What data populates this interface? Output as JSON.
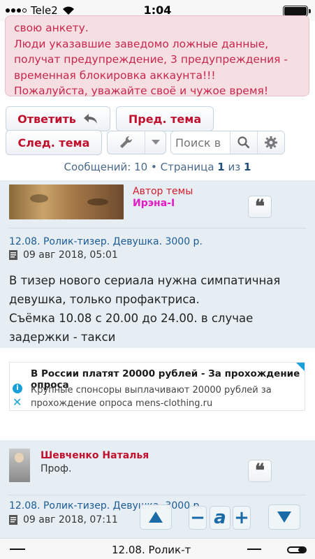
{
  "status_bar": {
    "carrier": "Tele2",
    "time": "1:04"
  },
  "warning": {
    "lines": [
      "свою анкету.",
      "Люди указавшие заведомо ложные данные,",
      "получат предупреждение, 3 предупреждения -",
      "временная блокировка аккаунта!!!",
      "Пожалуйста, уважайте своё и чужое время!"
    ]
  },
  "toolbar": {
    "reply_label": "Ответить",
    "prev_topic_label": "Пред. тема",
    "next_topic_label": "След. тема",
    "search_placeholder": "Поиск в"
  },
  "pagination": {
    "messages_label": "Сообщений:",
    "messages_count": "10",
    "separator": "•",
    "page_label": "Страница",
    "page_current": "1",
    "of_label": "из",
    "page_total": "1"
  },
  "posts": [
    {
      "author_label": "Автор темы",
      "author": "Ирэна-I",
      "title": "12.08. Ролик-тизер. Девушка. 3000 р.",
      "date": "09 авг 2018, 05:01",
      "body": [
        "В тизер нового сериала нужна симпатичная",
        "девушка, только профактриса.",
        "Съёмка 10.08 с 20.00 до 24.00. в случае",
        "задержки - такси"
      ]
    },
    {
      "author": "Шевченко Наталья",
      "role": "Проф.",
      "title": "12.08. Ролик-тизер. Девушка. 3000 р.",
      "date": "09 авг 2018, 07:11"
    }
  ],
  "ad": {
    "title": "В России платят 20000 рублей - За прохождение опроса",
    "text": "Крупные спонсоры выплачивают 20000 рублей за прохождение опроса mens-clothing.ru"
  },
  "float_controls": {
    "minus": "−",
    "font": "a",
    "plus": "+"
  },
  "bottom_bar": {
    "title": "12.08. Ролик-т"
  }
}
